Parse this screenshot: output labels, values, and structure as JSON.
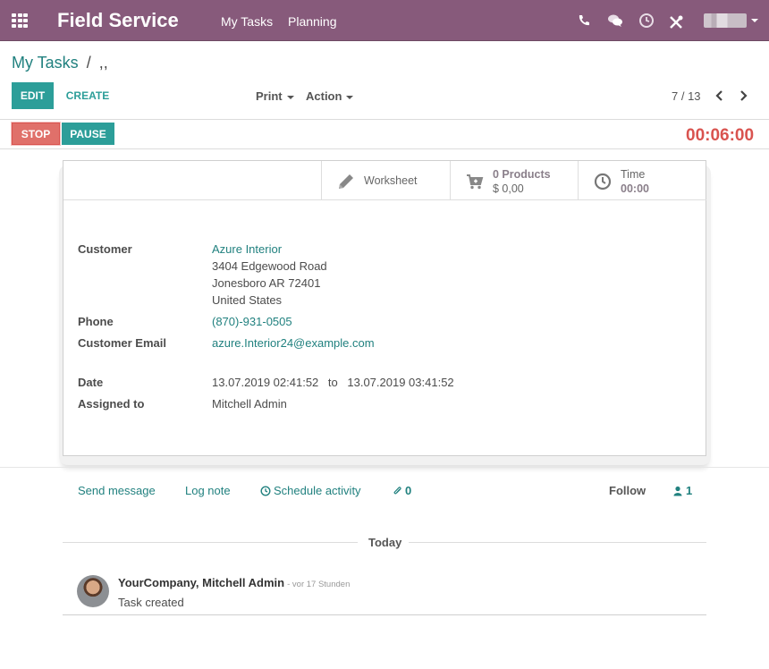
{
  "navbar": {
    "brand": "Field Service",
    "menu": [
      "My Tasks",
      "Planning"
    ],
    "user_name": "",
    "colors": {
      "primary": "#875a7b"
    }
  },
  "control": {
    "breadcrumb_parent": "My Tasks",
    "breadcrumb_sep": "/",
    "breadcrumb_current": ",,",
    "edit_label": "EDIT",
    "create_label": "CREATE",
    "print_label": "Print",
    "action_label": "Action",
    "pager": "7 / 13"
  },
  "status": {
    "stop_label": "STOP",
    "pause_label": "PAUSE",
    "timer": "00:06:00"
  },
  "buttons": {
    "worksheet_label": "Worksheet",
    "products_count": "0 Products",
    "products_amount": "$ 0,00",
    "time_label": "Time",
    "time_value": "00:00"
  },
  "form": {
    "customer_label": "Customer",
    "customer_name": "Azure Interior",
    "address_line1": "3404 Edgewood Road",
    "address_line2": "Jonesboro AR 72401",
    "address_line3": "United States",
    "phone_label": "Phone",
    "phone": "(870)-931-0505",
    "email_label": "Customer Email",
    "email": "azure.Interior24@example.com",
    "date_label": "Date",
    "date_start": "13.07.2019 02:41:52",
    "date_to": "to",
    "date_end": "13.07.2019 03:41:52",
    "assigned_label": "Assigned to",
    "assigned_to": "Mitchell Admin"
  },
  "chatter": {
    "send_message": "Send message",
    "log_note": "Log note",
    "schedule_activity": "Schedule activity",
    "attachments": "0",
    "follow": "Follow",
    "followers": "1",
    "day_label": "Today",
    "messages": [
      {
        "author": "YourCompany, Mitchell Admin",
        "date": "- vor 17 Stunden",
        "body": "Task created"
      }
    ]
  },
  "icons": [
    "apps-icon",
    "phone-icon",
    "chat-icon",
    "clock-icon",
    "tools-icon",
    "caret-down-icon",
    "chevron-left-icon",
    "chevron-right-icon",
    "pencil-icon",
    "cart-plus-icon",
    "clock-icon",
    "paperclip-icon",
    "user-icon"
  ]
}
